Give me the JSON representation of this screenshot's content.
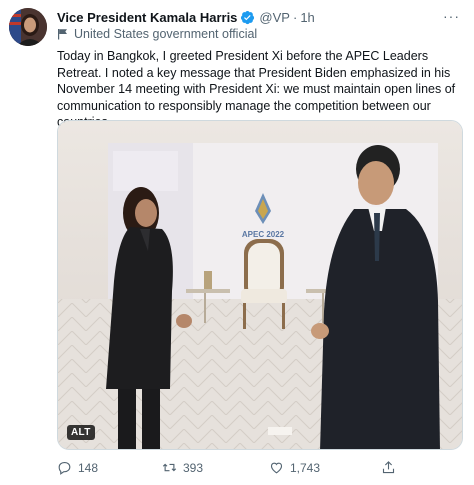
{
  "tweet": {
    "name": "Vice President Kamala Harris",
    "handle": "@VP",
    "separator": "·",
    "time": "1h",
    "more": "···",
    "account_label": "United States government official",
    "text": "Today in Bangkok, I greeted President Xi before the APEC Leaders Retreat. I noted a key message that President Biden emphasized in his November 14 meeting with President Xi: we must maintain open lines of communication to responsibly manage the competition between our countries.",
    "media": {
      "sign_text": "APEC 2022",
      "alt_badge": "ALT"
    },
    "actions": {
      "reply_count": "148",
      "retweet_count": "393",
      "like_count": "1,743"
    }
  },
  "colors": {
    "text": "#0f1419",
    "secondary": "#536471",
    "verified": "#1d9bf0",
    "border": "#cfd9de"
  },
  "icons": [
    "verified-badge-icon",
    "government-flag-icon",
    "reply-icon",
    "retweet-icon",
    "like-icon",
    "share-icon"
  ]
}
